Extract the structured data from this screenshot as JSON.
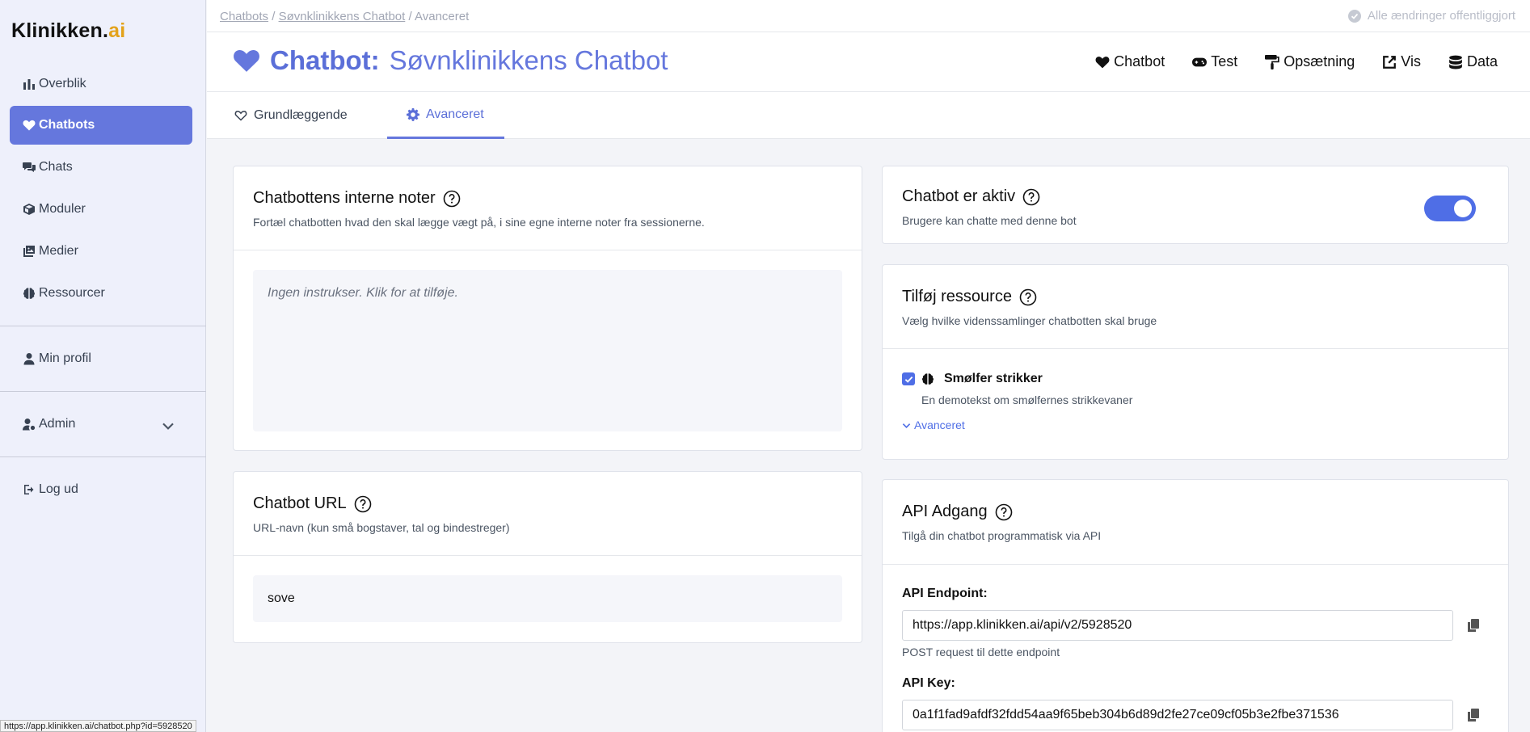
{
  "logo": {
    "main": "Klinikken.",
    "accent": "ai"
  },
  "sidebar": {
    "items": [
      {
        "label": "Overblik"
      },
      {
        "label": "Chatbots"
      },
      {
        "label": "Chats"
      },
      {
        "label": "Moduler"
      },
      {
        "label": "Medier"
      },
      {
        "label": "Ressourcer"
      }
    ],
    "profile": "Min profil",
    "admin": "Admin",
    "logout": "Log ud"
  },
  "status_url": "https://app.klinikken.ai/chatbot.php?id=5928520",
  "breadcrumb": {
    "crumb1": "Chatbots",
    "sep": " / ",
    "crumb2": "Søvnklinikkens Chatbot",
    "crumb3": "Avanceret"
  },
  "saved_status": "Alle ændringer offentliggjort",
  "header": {
    "title_label": "Chatbot:",
    "title_name": "Søvnklinikkens Chatbot",
    "actions": [
      "Chatbot",
      "Test",
      "Opsætning",
      "Vis",
      "Data"
    ]
  },
  "tabs": [
    "Grundlæggende",
    "Avanceret"
  ],
  "notes_card": {
    "title": "Chatbottens interne noter",
    "subtitle": "Fortæl chatbotten hvad den skal lægge vægt på, i sine egne interne noter fra sessionerne.",
    "placeholder": "Ingen instrukser. Klik for at tilføje."
  },
  "url_card": {
    "title": "Chatbot URL",
    "subtitle": "URL-navn (kun små bogstaver, tal og bindestreger)",
    "value": "sove"
  },
  "active_card": {
    "title": "Chatbot er aktiv",
    "subtitle": "Brugere kan chatte med denne bot",
    "enabled": true
  },
  "resource_card": {
    "title": "Tilføj ressource",
    "subtitle": "Vælg hvilke videnssamlinger chatbotten skal bruge",
    "resource_name": "Smølfer strikker",
    "resource_desc": "En demotekst om smølfernes strikkevaner",
    "checked": true,
    "advanced": "Avanceret"
  },
  "api_card": {
    "title": "API Adgang",
    "subtitle": "Tilgå din chatbot programmatisk via API",
    "endpoint_label": "API Endpoint:",
    "endpoint_value": "https://app.klinikken.ai/api/v2/5928520",
    "endpoint_hint": "POST request til dette endpoint",
    "key_label": "API Key:",
    "key_value": "0a1f1fad9afdf32fdd54aa9f65beb304b6d89d2fe27ce09cf05b3e2fbe371536"
  },
  "colors": {
    "accent": "#6577dd",
    "toggle": "#4f6ee6",
    "logo_accent": "#e3a21a"
  }
}
